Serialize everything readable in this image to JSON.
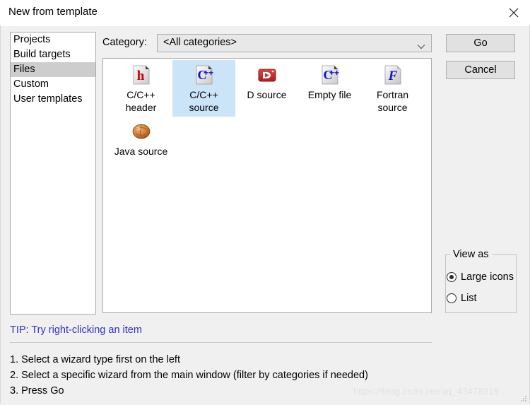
{
  "window": {
    "title": "New from template",
    "close_icon": "close-icon"
  },
  "sidebar": {
    "items": [
      {
        "label": "Projects",
        "selected": false
      },
      {
        "label": "Build targets",
        "selected": false
      },
      {
        "label": "Files",
        "selected": true
      },
      {
        "label": "Custom",
        "selected": false
      },
      {
        "label": "User templates",
        "selected": false
      }
    ]
  },
  "category": {
    "label": "Category:",
    "value": "<All categories>",
    "chevron_icon": "chevron-down-icon"
  },
  "templates": {
    "items": [
      {
        "label": "C/C++ header",
        "icon": "c-header-file-icon",
        "selected": false
      },
      {
        "label": "C/C++ source",
        "icon": "cpp-source-file-icon",
        "selected": true
      },
      {
        "label": "D source",
        "icon": "d-source-icon",
        "selected": false
      },
      {
        "label": "Empty file",
        "icon": "cpp-source-file-icon",
        "selected": false
      },
      {
        "label": "Fortran source",
        "icon": "fortran-source-file-icon",
        "selected": false
      },
      {
        "label": "Java source",
        "icon": "java-source-icon",
        "selected": false
      }
    ]
  },
  "buttons": {
    "go": "Go",
    "cancel": "Cancel"
  },
  "view_as": {
    "legend": "View as",
    "options": [
      {
        "label": "Large icons",
        "checked": true
      },
      {
        "label": "List",
        "checked": false
      }
    ]
  },
  "tip": {
    "text": "TIP: Try right-clicking an item",
    "color": "#3232c8"
  },
  "instructions": {
    "lines": [
      "1. Select a wizard type first on the left",
      "2. Select a specific wizard from the main window (filter by categories if needed)",
      "3. Press Go"
    ]
  },
  "watermark": {
    "text": "https://blog.csdn.net/qq_43478319"
  },
  "colors": {
    "selection_blue": "#cce4f7",
    "sidebar_selection_gray": "#cdcdcd",
    "dialog_background": "#f0f0f0"
  }
}
